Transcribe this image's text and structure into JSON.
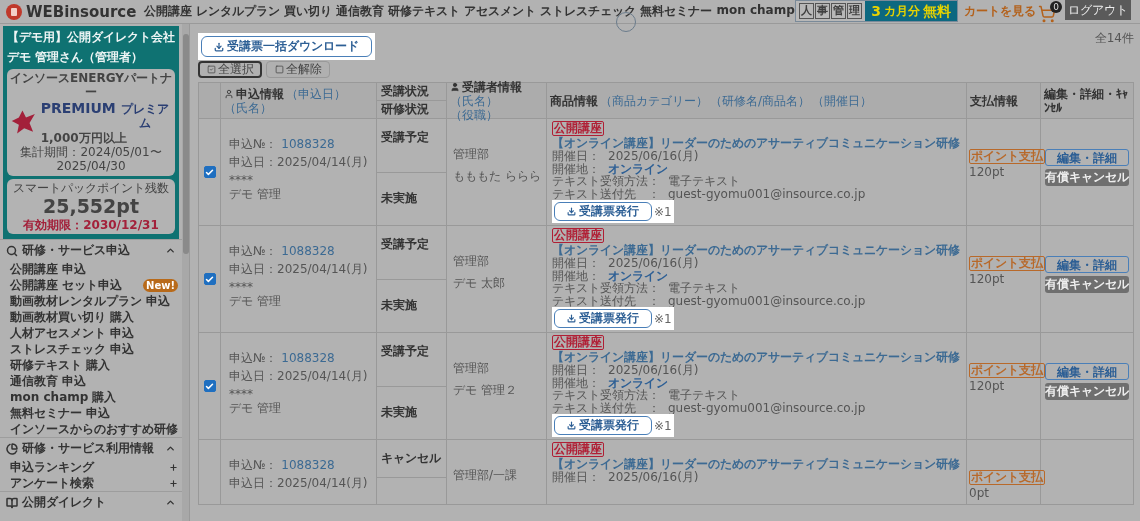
{
  "header": {
    "logo": "WEBinsource",
    "nav": [
      "公開講座",
      "レンタルプラン",
      "買い切り",
      "通信教育",
      "研修テキスト",
      "アセスメント",
      "ストレスチェック",
      "無料セミナー",
      "mon champ"
    ],
    "banner": {
      "badge_chars": [
        "人",
        "事",
        "管",
        "理"
      ],
      "offer_number": "3",
      "offer_unit": "カ月分",
      "offer_text": "無料"
    },
    "cart": {
      "label": "カートを見る",
      "count": "0"
    },
    "logout": "ログアウト"
  },
  "sidebar": {
    "company": "【デモ用】公開ダイレクト会社",
    "user": "デモ 管理さん（管理者）",
    "partner": {
      "title": "インソースENERGYパートナー",
      "rank": "PREMIUM",
      "rank_kana": "プレミアム",
      "amount": "1,000万円以上",
      "period": "集計期間：2024/05/01〜2025/04/30"
    },
    "points": {
      "label": "スマートパックポイント残数",
      "value": "25,552pt",
      "expiry": "有効期限：2030/12/31"
    },
    "sections": [
      {
        "title": "研修・サービス申込",
        "expanded": true,
        "items": [
          {
            "label": "公開講座 申込",
            "kind": "link"
          },
          {
            "label": "公開講座 セット申込",
            "kind": "link",
            "badge": "New!"
          },
          {
            "label": "動画教材レンタルプラン 申込",
            "kind": "link"
          },
          {
            "label": "動画教材買い切り 購入",
            "kind": "link"
          },
          {
            "label": "人材アセスメント 申込",
            "kind": "link"
          },
          {
            "label": "ストレスチェック 申込",
            "kind": "link"
          },
          {
            "label": "研修テキスト 購入",
            "kind": "link"
          },
          {
            "label": "通信教育 申込",
            "kind": "link"
          },
          {
            "label": "mon champ 購入",
            "kind": "link"
          },
          {
            "label": "無料セミナー 申込",
            "kind": "link"
          },
          {
            "label": "インソースからのおすすめ研修",
            "kind": "link"
          }
        ]
      },
      {
        "title": "研修・サービス利用情報",
        "expanded": true,
        "items": [
          {
            "label": "申込ランキング",
            "kind": "expandable"
          },
          {
            "label": "アンケート検索",
            "kind": "expandable"
          }
        ]
      },
      {
        "title": "公開ダイレクト",
        "expanded": true
      }
    ]
  },
  "main": {
    "bulk_download": "受講票一括ダウンロード",
    "select_buttons": [
      {
        "label": "全選択",
        "selected": true
      },
      {
        "label": "全解除",
        "selected": false
      }
    ],
    "total": "全14件",
    "table": {
      "columns": [
        {
          "label": "申込情報",
          "sorts": [
            "（申込日）",
            "（氏名）"
          ]
        },
        {
          "labels": [
            "受講状況",
            "研修状況"
          ]
        },
        {
          "label": "受講者情報",
          "sorts": [
            "（氏名）",
            "（役職）"
          ]
        },
        {
          "label": "商品情報",
          "sorts": [
            "（商品カテゴリー）",
            "（研修名/商品名）",
            "（開催日）"
          ]
        },
        {
          "label": "支払情報"
        },
        {
          "label": "編集・詳細・ｷｬﾝｾﾙ"
        }
      ],
      "rows": [
        {
          "checked": true,
          "no_label": "申込№：",
          "no": "1088328",
          "date": "申込日：2025/04/14(月)",
          "masked": "****",
          "applicant": "デモ 管理",
          "attendance": "受講予定",
          "training": "未実施",
          "department": "管理部",
          "attendee": "もももた ららら",
          "category": "公開講座",
          "title": "【オンライン講座】リーダーのためのアサーティブコミュニケーション研修",
          "details": [
            {
              "label": "開催日：",
              "value": "2025/06/16(月)",
              "kind": "text"
            },
            {
              "label": "開催地：",
              "value": "オンライン",
              "kind": "link"
            },
            {
              "label": "テキスト受領方法：",
              "value": "電子テキスト",
              "kind": "text"
            },
            {
              "label": "テキスト送付先　：",
              "value": "guest-gyomu001@insource.co.jp",
              "kind": "text"
            }
          ],
          "ticket": "受講票発行",
          "note": "※1",
          "payment_tag": "ポイント支払",
          "payment": "120pt",
          "edit": "編集・詳細",
          "cancel": "有償キャンセル"
        },
        {
          "checked": true,
          "no_label": "申込№：",
          "no": "1088328",
          "date": "申込日：2025/04/14(月)",
          "masked": "****",
          "applicant": "デモ 管理",
          "attendance": "受講予定",
          "training": "未実施",
          "department": "管理部",
          "attendee": "デモ 太郎",
          "category": "公開講座",
          "title": "【オンライン講座】リーダーのためのアサーティブコミュニケーション研修",
          "details": [
            {
              "label": "開催日：",
              "value": "2025/06/16(月)",
              "kind": "text"
            },
            {
              "label": "開催地：",
              "value": "オンライン",
              "kind": "link"
            },
            {
              "label": "テキスト受領方法：",
              "value": "電子テキスト",
              "kind": "text"
            },
            {
              "label": "テキスト送付先　：",
              "value": "guest-gyomu001@insource.co.jp",
              "kind": "text"
            }
          ],
          "ticket": "受講票発行",
          "note": "※1",
          "payment_tag": "ポイント支払",
          "payment": "120pt",
          "edit": "編集・詳細",
          "cancel": "有償キャンセル"
        },
        {
          "checked": true,
          "no_label": "申込№：",
          "no": "1088328",
          "date": "申込日：2025/04/14(月)",
          "masked": "****",
          "applicant": "デモ 管理",
          "attendance": "受講予定",
          "training": "未実施",
          "department": "管理部",
          "attendee": "デモ 管理２",
          "category": "公開講座",
          "title": "【オンライン講座】リーダーのためのアサーティブコミュニケーション研修",
          "details": [
            {
              "label": "開催日：",
              "value": "2025/06/16(月)",
              "kind": "text"
            },
            {
              "label": "開催地：",
              "value": "オンライン",
              "kind": "link"
            },
            {
              "label": "テキスト受領方法：",
              "value": "電子テキスト",
              "kind": "text"
            },
            {
              "label": "テキスト送付先　：",
              "value": "guest-gyomu001@insource.co.jp",
              "kind": "text"
            }
          ],
          "ticket": "受講票発行",
          "note": "※1",
          "payment_tag": "ポイント支払",
          "payment": "120pt",
          "edit": "編集・詳細",
          "cancel": "有償キャンセル"
        },
        {
          "no_label": "申込№：",
          "no": "1088328",
          "date": "申込日：2025/04/14(月)",
          "attendance": "キャンセル",
          "department": "管理部/一課",
          "category": "公開講座",
          "title": "【オンライン講座】リーダーのためのアサーティブコミュニケーション研修",
          "details": [
            {
              "label": "開催日：",
              "value": "2025/06/16(月)",
              "kind": "text"
            }
          ],
          "payment_tag": "ポイント支払",
          "payment": "0pt"
        }
      ]
    }
  }
}
